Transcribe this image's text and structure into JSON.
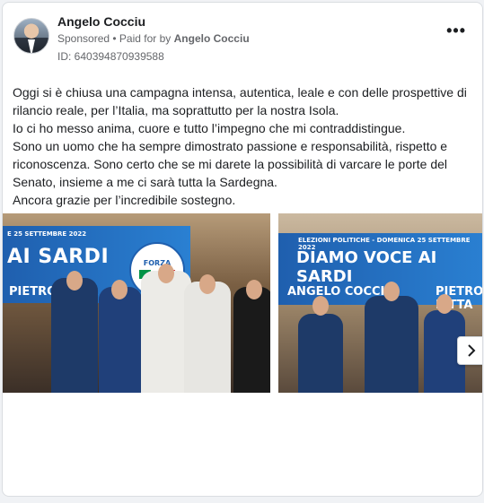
{
  "post": {
    "author_name": "Angelo Cocciu",
    "sponsored_label": "Sponsored",
    "paid_for_prefix": "• Paid for by",
    "paid_for_name": "Angelo Cocciu",
    "ad_id": "ID: 640394870939588",
    "more_icon": "more-horizontal-icon",
    "body_lines": [
      "Oggi si è chiusa una campagna intensa, autentica, leale e con delle prospettive di rilancio reale, per l’Italia, ma soprattutto per la nostra Isola.",
      "Io ci ho messo anima, cuore e tutto l’impegno che mi contraddistingue.",
      "Sono un uomo che ha sempre dimostrato passione e responsabilità, rispetto e riconoscenza. Sono certo che se mi darete la possibilità di varcare le porte del Senato, insieme a me ci sarà tutta la Sardegna.",
      "Ancora grazie per l’incredibile sostegno."
    ]
  },
  "carousel": {
    "slide1": {
      "banner_date": "E 25 SETTEMBRE 2022",
      "banner_big": "AI SARDI",
      "candidate": "PIETRO PITTA",
      "logo_text": "FORZA ITALIA BERLUSCONI"
    },
    "slide2": {
      "banner_date": "ELEZIONI POLITICHE - DOMENICA 25 SETTEMBRE 2022",
      "banner_big": "DIAMO VOCE AI SARDI",
      "candidate_left": "ANGELO COCCIU",
      "candidate_right": "PIETRO PITTA"
    },
    "next_icon": "chevron-right-icon"
  },
  "colors": {
    "banner_blue": "#1f5fae",
    "meta_gray": "#65676b"
  }
}
